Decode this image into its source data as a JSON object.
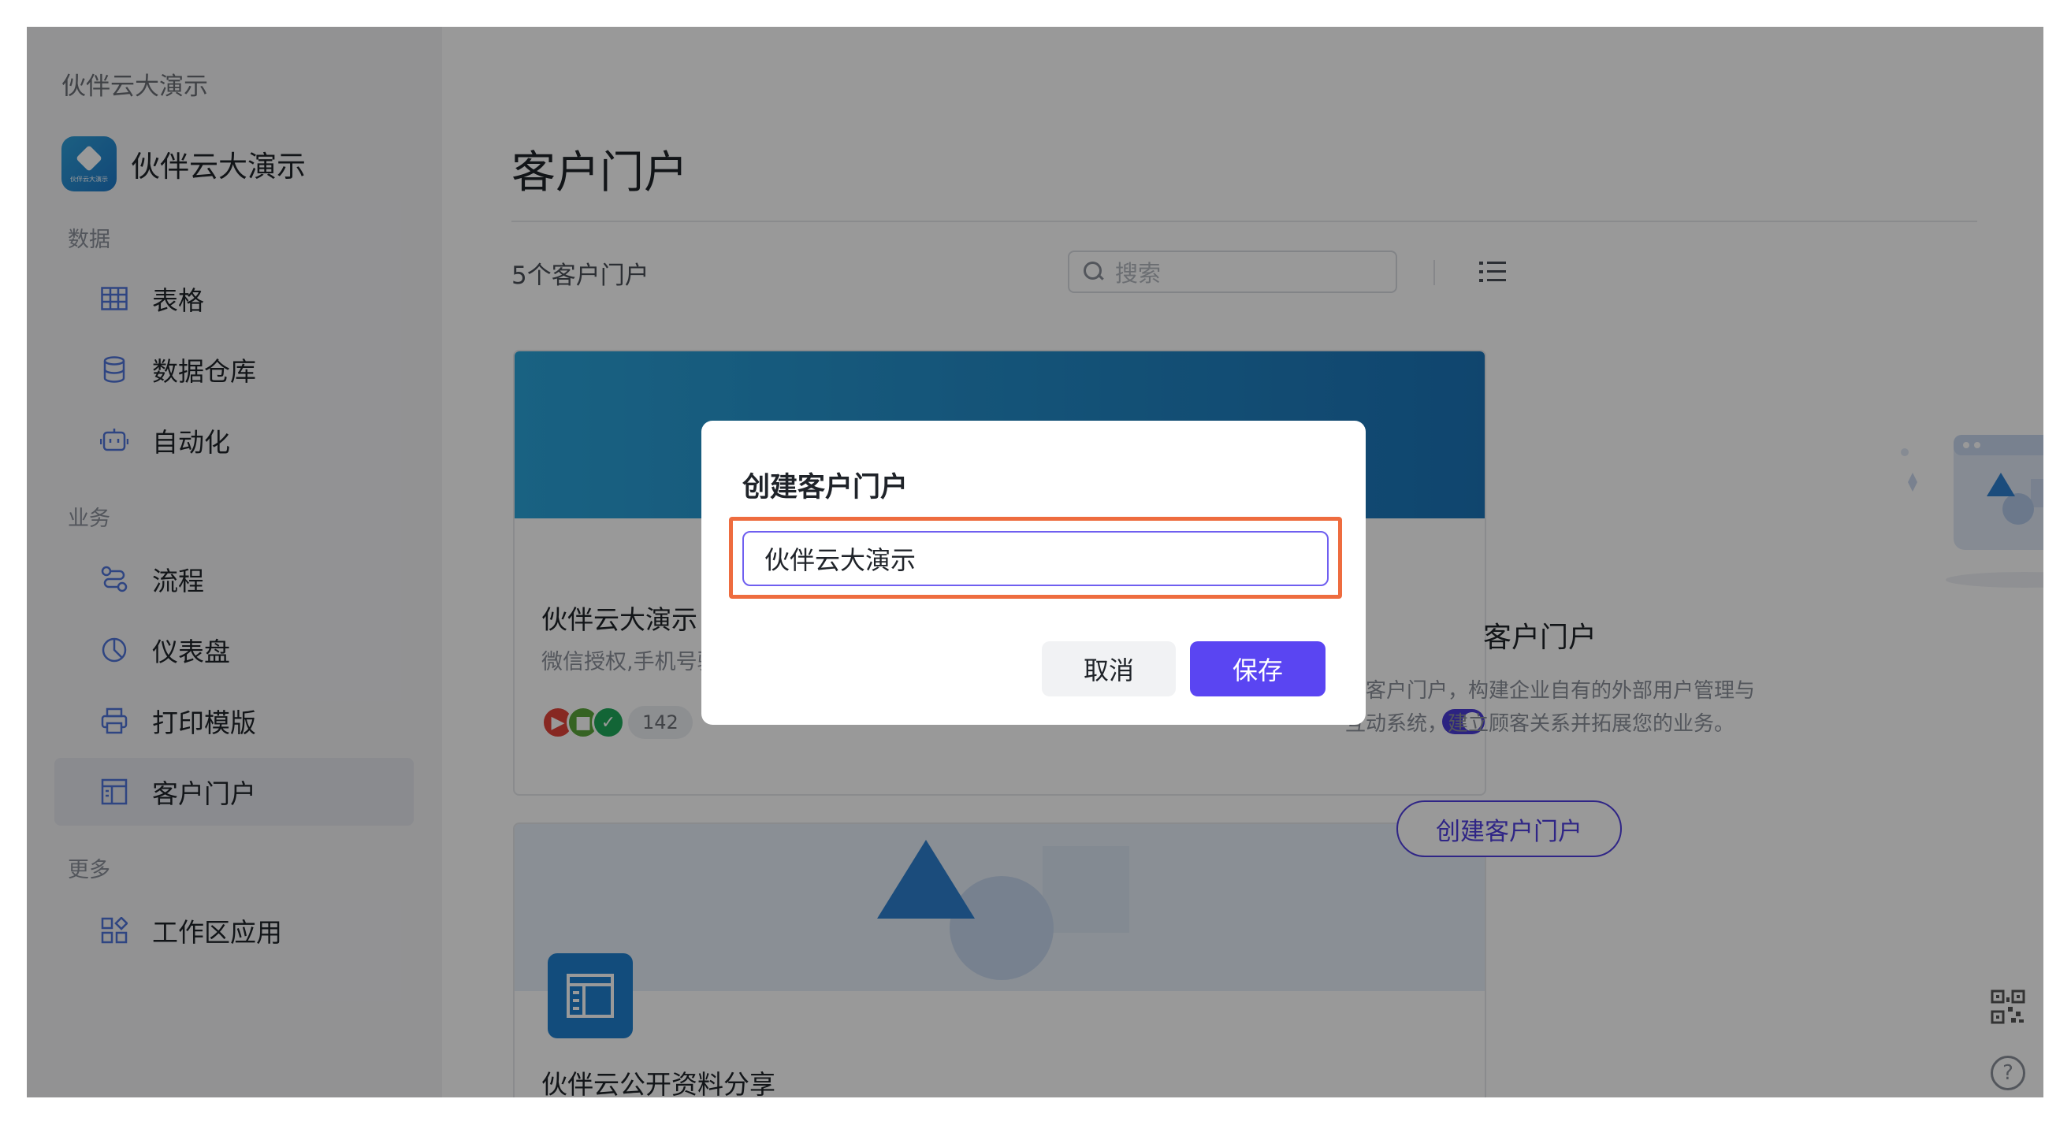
{
  "workspace": {
    "title": "伙伴云大演示"
  },
  "app": {
    "name": "伙伴云大演示"
  },
  "sidebar": {
    "sections": [
      {
        "label": "数据"
      },
      {
        "label": "业务"
      },
      {
        "label": "更多"
      }
    ],
    "items": [
      {
        "label": "表格",
        "icon": "table-icon"
      },
      {
        "label": "数据仓库",
        "icon": "database-icon"
      },
      {
        "label": "自动化",
        "icon": "robot-icon"
      },
      {
        "label": "流程",
        "icon": "workflow-icon"
      },
      {
        "label": "仪表盘",
        "icon": "dashboard-icon"
      },
      {
        "label": "打印模版",
        "icon": "printer-icon"
      },
      {
        "label": "客户门户",
        "icon": "portal-icon",
        "active": true
      },
      {
        "label": "工作区应用",
        "icon": "apps-icon"
      }
    ]
  },
  "main": {
    "title": "客户门户",
    "count_text": "5个客户门户",
    "search": {
      "placeholder": "搜索"
    },
    "cards": [
      {
        "title": "伙伴云大演示",
        "subtitle": "微信授权,手机号验",
        "member_count": "142",
        "enabled": true
      },
      {
        "title": "伙伴云公开资料分享"
      }
    ]
  },
  "empty_panel": {
    "title": "客户门户",
    "description": "借助客户门户，构建企业自有的外部用户管理与互动系统，建立顾客关系并拓展您的业务。",
    "button": "创建客户门户"
  },
  "dialog": {
    "title": "创建客户门户",
    "input_value": "伙伴云大演示",
    "cancel": "取消",
    "save": "保存"
  },
  "colors": {
    "accent": "#5a45f2",
    "highlight": "#ee6c3f",
    "sidebar_bg": "#f3f4f6"
  }
}
